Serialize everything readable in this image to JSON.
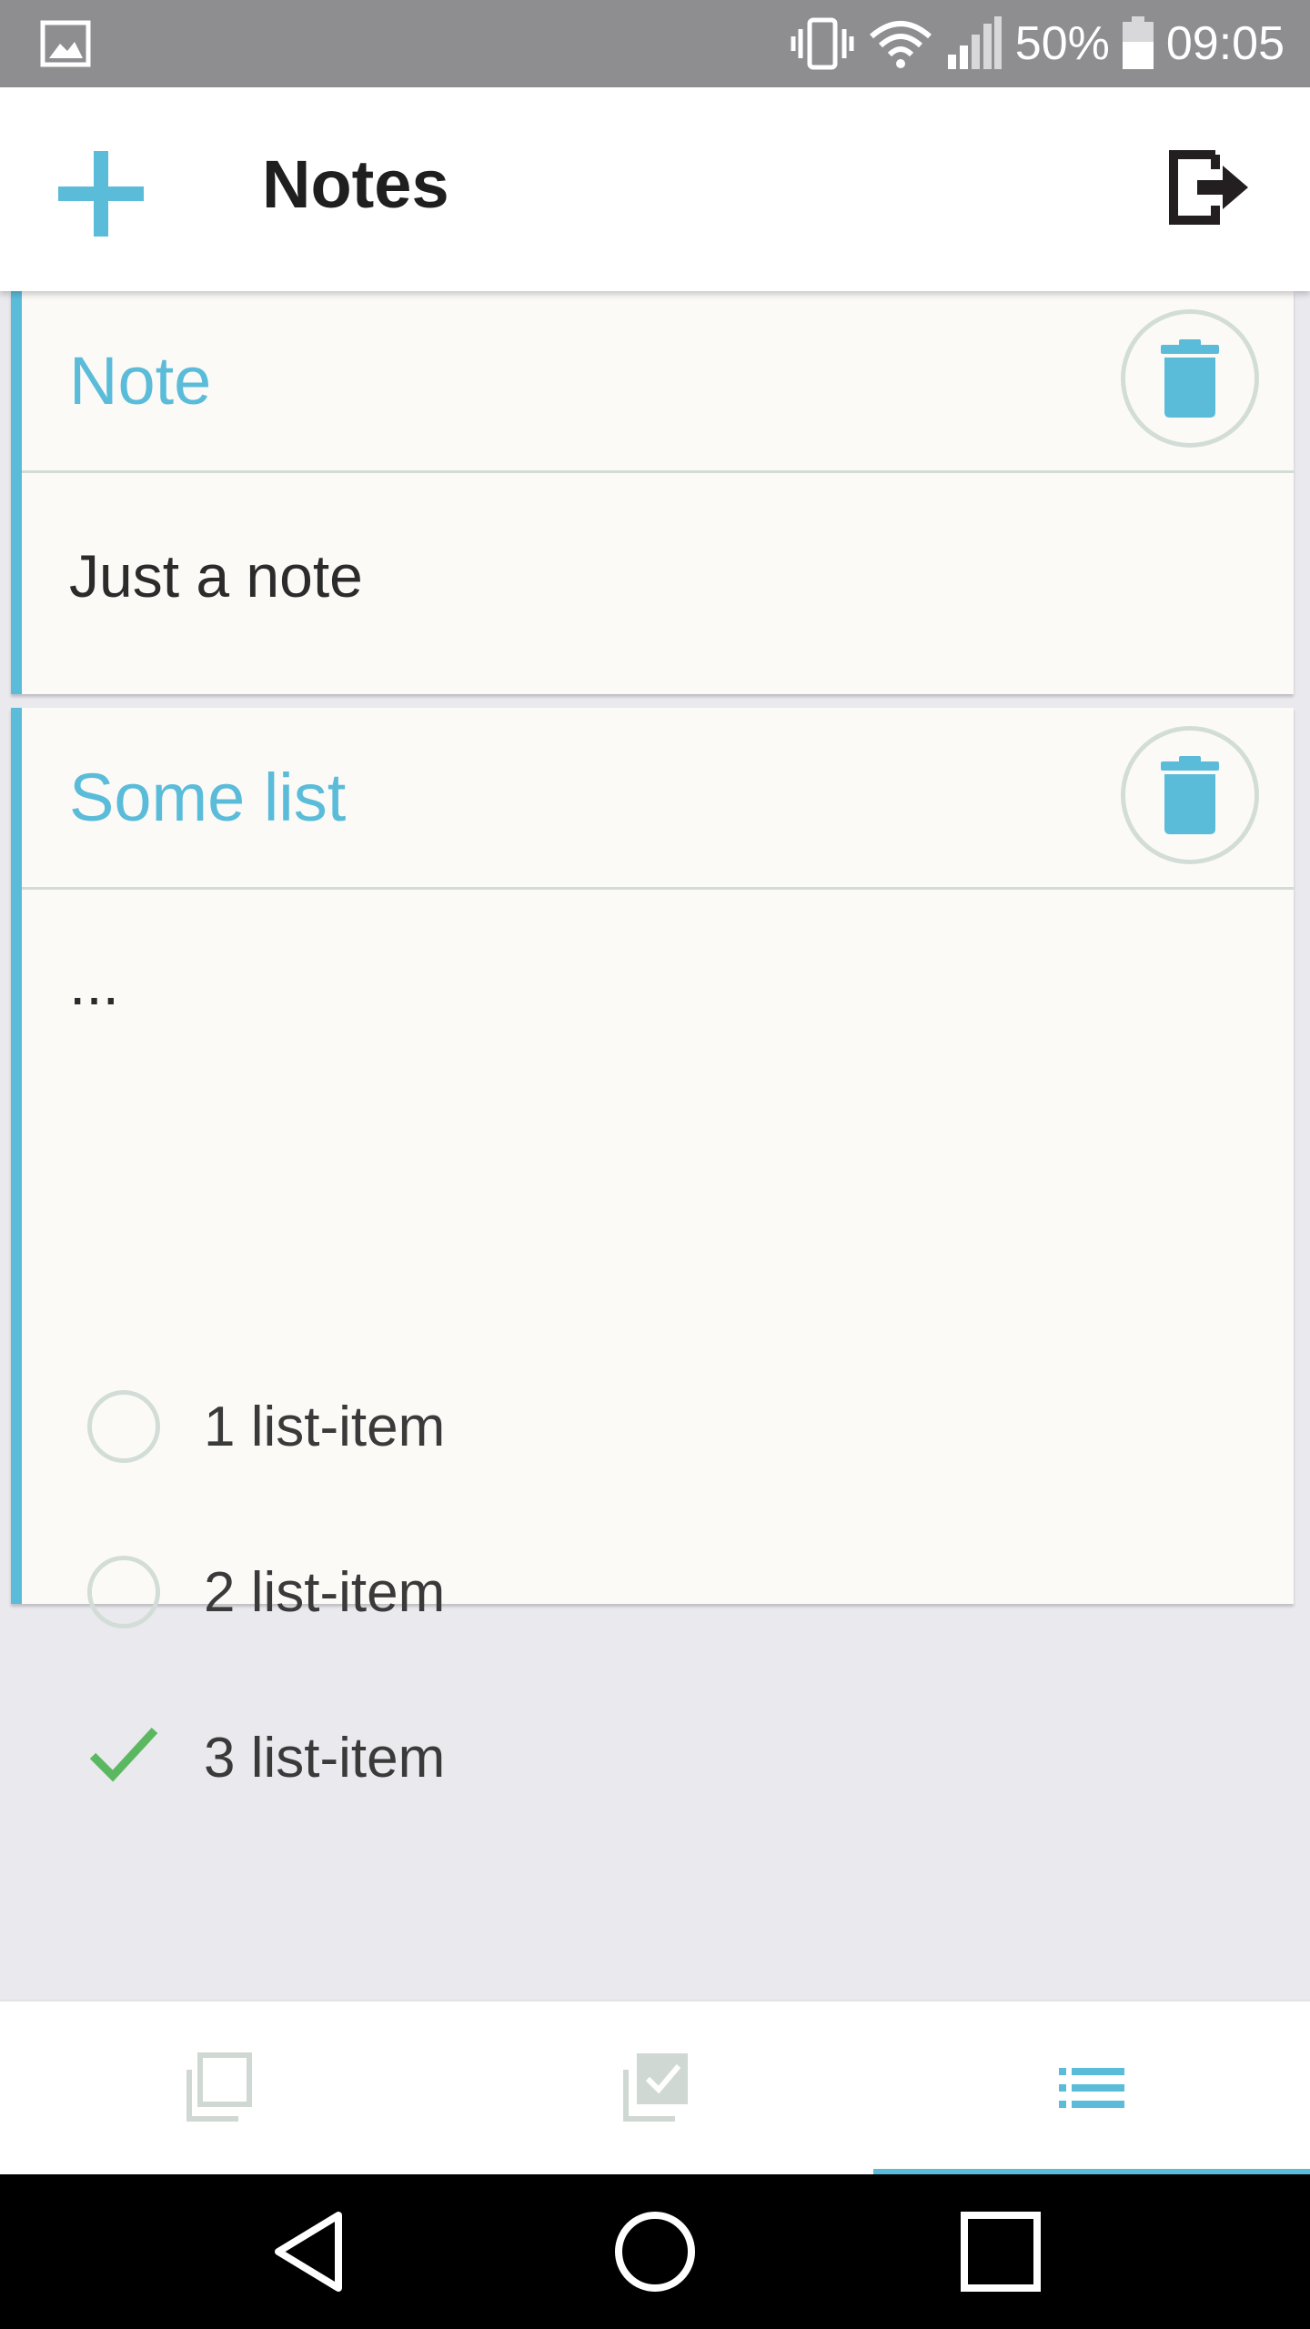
{
  "status_bar": {
    "battery": "50%",
    "time": "09:05"
  },
  "app_bar": {
    "title": "Notes",
    "add_icon": "plus-icon",
    "logout_icon": "logout-icon"
  },
  "notes": [
    {
      "title": "Note",
      "body": "Just a note"
    },
    {
      "title": "Some list",
      "body": "...",
      "items": [
        {
          "label": "1 list-item",
          "checked": false
        },
        {
          "label": "2 list-item",
          "checked": false
        },
        {
          "label": "3 list-item",
          "checked": true
        }
      ]
    }
  ],
  "tabs": [
    {
      "icon": "notes-tab-icon",
      "active": false
    },
    {
      "icon": "checklist-tab-icon",
      "active": false
    },
    {
      "icon": "list-tab-icon",
      "active": true
    }
  ],
  "colors": {
    "accent": "#5bbcda",
    "check": "#5cb860",
    "divider": "#d3ddd8",
    "card_bg": "#fcfaf7",
    "page_bg": "#e9e9ee"
  }
}
